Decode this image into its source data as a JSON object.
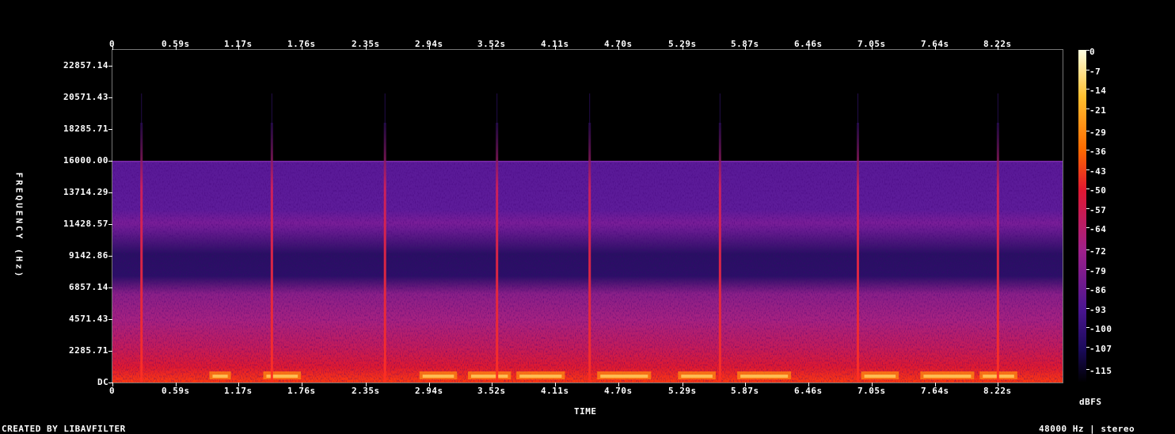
{
  "chart_data": {
    "type": "heatmap",
    "title": "",
    "xlabel": "TIME",
    "ylabel": "FREQUENCY (Hz)",
    "x_ticks": [
      "0",
      "0.59s",
      "1.17s",
      "1.76s",
      "2.35s",
      "2.94s",
      "3.52s",
      "4.11s",
      "4.70s",
      "5.29s",
      "5.87s",
      "6.46s",
      "7.05s",
      "7.64s",
      "8.22s"
    ],
    "x_tick_values": [
      0,
      0.59,
      1.17,
      1.76,
      2.35,
      2.94,
      3.52,
      4.11,
      4.7,
      5.29,
      5.87,
      6.46,
      7.05,
      7.64,
      8.22
    ],
    "xlim": [
      0,
      8.82
    ],
    "y_ticks": [
      "22857.14",
      "20571.43",
      "18285.71",
      "16000.00",
      "13714.29",
      "11428.57",
      "9142.86",
      "6857.14",
      "4571.43",
      "2285.71",
      "DC"
    ],
    "y_tick_values": [
      22857.14,
      20571.43,
      18285.71,
      16000.0,
      13714.29,
      11428.57,
      9142.86,
      6857.14,
      4571.43,
      2285.71,
      0
    ],
    "ylim": [
      0,
      24000
    ],
    "colorbar_ticks": [
      "0",
      "-7",
      "-14",
      "-21",
      "-29",
      "-36",
      "-43",
      "-50",
      "-57",
      "-64",
      "-72",
      "-79",
      "-86",
      "-93",
      "-100",
      "-107",
      "-115"
    ],
    "colorbar_label": "dBFS",
    "colorbar_range": [
      -120,
      0
    ],
    "lowpass_cutoff_hz": 16000,
    "transients_s": [
      0.27,
      1.48,
      2.53,
      3.57,
      4.43,
      5.64,
      6.92,
      8.22
    ],
    "colormap": [
      "#000000",
      "#1a0a5a",
      "#4a1590",
      "#a0208a",
      "#e01830",
      "#ff6a00",
      "#ffc030",
      "#ffffe0"
    ]
  },
  "footer": {
    "credit": "CREATED BY LIBAVFILTER",
    "info": "48000 Hz | stereo"
  }
}
